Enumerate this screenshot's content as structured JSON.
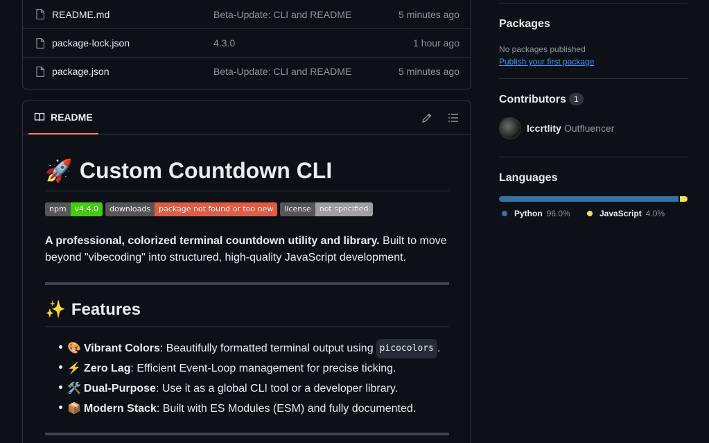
{
  "files": [
    {
      "name": "README.md",
      "message": "Beta-Update: CLI and README",
      "time": "5 minutes ago"
    },
    {
      "name": "package-lock.json",
      "message": "4.3.0",
      "time": "1 hour ago"
    },
    {
      "name": "package.json",
      "message": "Beta-Update: CLI and README",
      "time": "5 minutes ago"
    }
  ],
  "readme": {
    "tab_label": "README",
    "title_emoji": "🚀",
    "title": "Custom Countdown CLI",
    "badges": [
      {
        "label": "npm",
        "value": "v4.4.0",
        "color": "#4c1"
      },
      {
        "label": "downloads",
        "value": "package not found or too new",
        "color": "#e05d44"
      },
      {
        "label": "license",
        "value": "not specified",
        "color": "#9f9f9f"
      }
    ],
    "intro_bold": "A professional, colorized terminal countdown utility and library.",
    "intro_rest": " Built to move beyond \"vibecoding\" into structured, high-quality JavaScript development.",
    "features_emoji": "✨",
    "features_heading": "Features",
    "features": [
      {
        "emoji": "🎨",
        "name": "Vibrant Colors",
        "text": ": Beautifully formatted terminal output using",
        "code": "picocolors",
        "after": "."
      },
      {
        "emoji": "⚡",
        "name": "Zero Lag",
        "text": ": Efficient Event-Loop management for precise ticking.",
        "code": "",
        "after": ""
      },
      {
        "emoji": "🛠️",
        "name": "Dual-Purpose",
        "text": ": Use it as a global CLI tool or a developer library.",
        "code": "",
        "after": ""
      },
      {
        "emoji": "📦",
        "name": "Modern Stack",
        "text": ": Built with ES Modules (ESM) and fully documented.",
        "code": "",
        "after": ""
      }
    ]
  },
  "sidebar": {
    "packages_title": "Packages",
    "packages_empty": "No packages published",
    "packages_link": "Publish your first package",
    "contributors_title": "Contributors",
    "contributors_count": "1",
    "contributor_user": "lccrtlity",
    "contributor_name": "Outfluencer",
    "languages_title": "Languages",
    "languages": [
      {
        "name": "Python",
        "percent": "96.0%",
        "color": "#3572a5"
      },
      {
        "name": "JavaScript",
        "percent": "4.0%",
        "color": "#f1e05a"
      }
    ]
  }
}
